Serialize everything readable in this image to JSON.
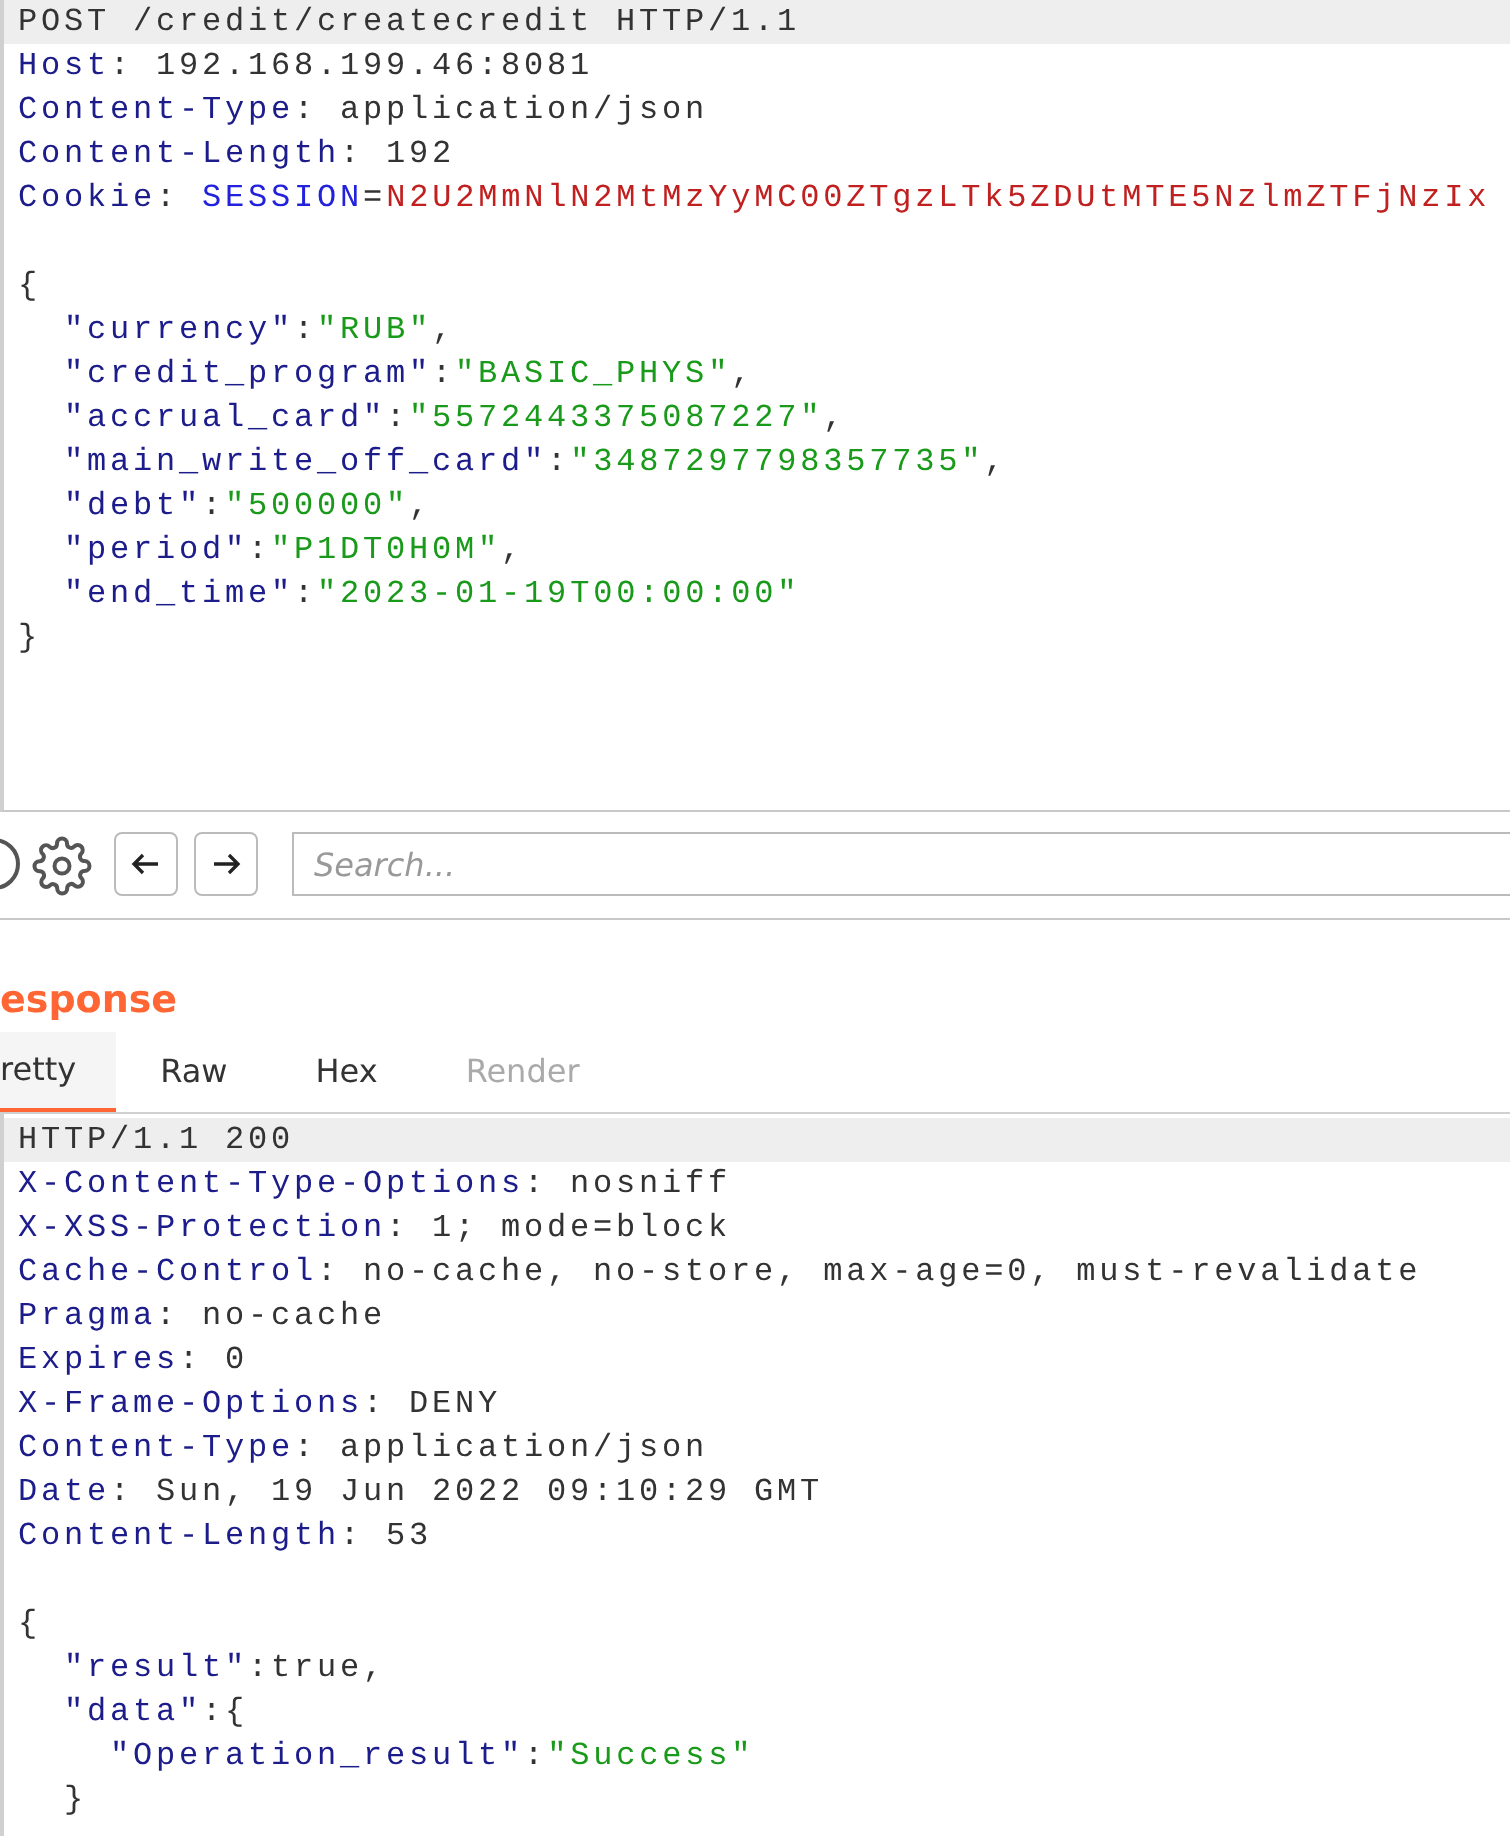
{
  "request": {
    "lines": [
      {
        "parts": [
          {
            "kind": "plain",
            "text": "POST /credit/createcredit HTTP/1.1"
          }
        ]
      },
      {
        "parts": [
          {
            "kind": "name",
            "text": "Host"
          },
          {
            "kind": "plain",
            "text": ": 192.168.199.46:8081"
          }
        ]
      },
      {
        "parts": [
          {
            "kind": "name",
            "text": "Content-Type"
          },
          {
            "kind": "plain",
            "text": ": application/json"
          }
        ]
      },
      {
        "parts": [
          {
            "kind": "name",
            "text": "Content-Length"
          },
          {
            "kind": "plain",
            "text": ": 192"
          }
        ]
      },
      {
        "parts": [
          {
            "kind": "name",
            "text": "Cookie"
          },
          {
            "kind": "plain",
            "text": ": "
          },
          {
            "kind": "cookie",
            "text": "SESSION"
          },
          {
            "kind": "plain",
            "text": "="
          },
          {
            "kind": "cookie_value",
            "text": "N2U2MmNlN2MtMzYyMC00ZTgzLTk5ZDUtMTE5NzlmZTFjNzIx"
          }
        ]
      },
      {
        "kind": "blank"
      },
      {
        "parts": [
          {
            "kind": "plain",
            "text": "{"
          }
        ]
      },
      {
        "parts": [
          {
            "kind": "key",
            "text": "  \"currency\""
          },
          {
            "kind": "plain",
            "text": ":"
          },
          {
            "kind": "string",
            "text": "\"RUB\""
          },
          {
            "kind": "plain",
            "text": ","
          }
        ]
      },
      {
        "parts": [
          {
            "kind": "key",
            "text": "  \"credit_program\""
          },
          {
            "kind": "plain",
            "text": ":"
          },
          {
            "kind": "string",
            "text": "\"BASIC_PHYS\""
          },
          {
            "kind": "plain",
            "text": ","
          }
        ]
      },
      {
        "parts": [
          {
            "kind": "key",
            "text": "  \"accrual_card\""
          },
          {
            "kind": "plain",
            "text": ":"
          },
          {
            "kind": "string",
            "text": "\"5572443375087227\""
          },
          {
            "kind": "plain",
            "text": ","
          }
        ]
      },
      {
        "parts": [
          {
            "kind": "key",
            "text": "  \"main_write_off_card\""
          },
          {
            "kind": "plain",
            "text": ":"
          },
          {
            "kind": "string",
            "text": "\"3487297798357735\""
          },
          {
            "kind": "plain",
            "text": ","
          }
        ]
      },
      {
        "parts": [
          {
            "kind": "key",
            "text": "  \"debt\""
          },
          {
            "kind": "plain",
            "text": ":"
          },
          {
            "kind": "string",
            "text": "\"500000\""
          },
          {
            "kind": "plain",
            "text": ","
          }
        ]
      },
      {
        "parts": [
          {
            "kind": "key",
            "text": "  \"period\""
          },
          {
            "kind": "plain",
            "text": ":"
          },
          {
            "kind": "string",
            "text": "\"P1DT0H0M\""
          },
          {
            "kind": "plain",
            "text": ","
          }
        ]
      },
      {
        "parts": [
          {
            "kind": "key",
            "text": "  \"end_time\""
          },
          {
            "kind": "plain",
            "text": ":"
          },
          {
            "kind": "string",
            "text": "\"2023-01-19T00:00:00\""
          }
        ]
      },
      {
        "parts": [
          {
            "kind": "plain",
            "text": "}"
          }
        ]
      }
    ]
  },
  "toolbar": {
    "search": {
      "placeholder": "Search..."
    }
  },
  "response": {
    "title": "esponse",
    "tabs": [
      {
        "label": "retty",
        "selected": true,
        "disabled": false
      },
      {
        "label": "Raw",
        "selected": false,
        "disabled": false
      },
      {
        "label": "Hex",
        "selected": false,
        "disabled": false
      },
      {
        "label": "Render",
        "selected": false,
        "disabled": true
      }
    ],
    "lines": [
      {
        "parts": [
          {
            "kind": "plain",
            "text": "HTTP/1.1 200"
          }
        ]
      },
      {
        "parts": [
          {
            "kind": "name",
            "text": "X-Content-Type-Options"
          },
          {
            "kind": "plain",
            "text": ": nosniff"
          }
        ]
      },
      {
        "parts": [
          {
            "kind": "name",
            "text": "X-XSS-Protection"
          },
          {
            "kind": "plain",
            "text": ": 1; mode=block"
          }
        ]
      },
      {
        "parts": [
          {
            "kind": "name",
            "text": "Cache-Control"
          },
          {
            "kind": "plain",
            "text": ": no-cache, no-store, max-age=0, must-revalidate"
          }
        ]
      },
      {
        "parts": [
          {
            "kind": "name",
            "text": "Pragma"
          },
          {
            "kind": "plain",
            "text": ": no-cache"
          }
        ]
      },
      {
        "parts": [
          {
            "kind": "name",
            "text": "Expires"
          },
          {
            "kind": "plain",
            "text": ": 0"
          }
        ]
      },
      {
        "parts": [
          {
            "kind": "name",
            "text": "X-Frame-Options"
          },
          {
            "kind": "plain",
            "text": ": DENY"
          }
        ]
      },
      {
        "parts": [
          {
            "kind": "name",
            "text": "Content-Type"
          },
          {
            "kind": "plain",
            "text": ": application/json"
          }
        ]
      },
      {
        "parts": [
          {
            "kind": "name",
            "text": "Date"
          },
          {
            "kind": "plain",
            "text": ": Sun, 19 Jun 2022 09:10:29 GMT"
          }
        ]
      },
      {
        "parts": [
          {
            "kind": "name",
            "text": "Content-Length"
          },
          {
            "kind": "plain",
            "text": ": 53"
          }
        ]
      },
      {
        "kind": "blank"
      },
      {
        "parts": [
          {
            "kind": "plain",
            "text": "{"
          }
        ]
      },
      {
        "parts": [
          {
            "kind": "key",
            "text": "  \"result\""
          },
          {
            "kind": "plain",
            "text": ":true,"
          }
        ]
      },
      {
        "parts": [
          {
            "kind": "key",
            "text": "  \"data\""
          },
          {
            "kind": "plain",
            "text": ":{"
          }
        ]
      },
      {
        "parts": [
          {
            "kind": "key",
            "text": "    \"Operation_result\""
          },
          {
            "kind": "plain",
            "text": ":"
          },
          {
            "kind": "string",
            "text": "\"Success\""
          }
        ]
      },
      {
        "parts": [
          {
            "kind": "plain",
            "text": "  }"
          }
        ]
      }
    ]
  }
}
